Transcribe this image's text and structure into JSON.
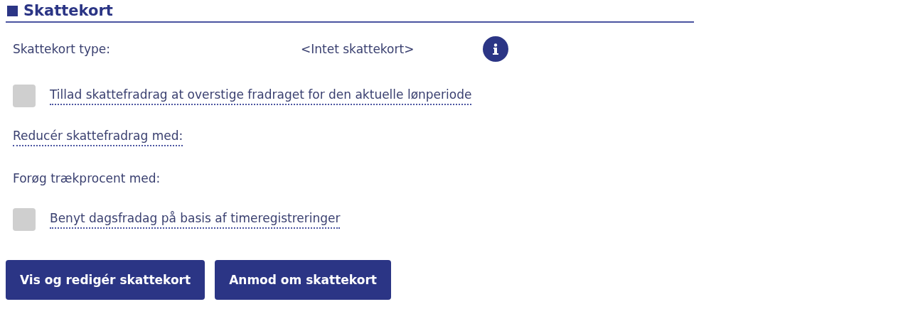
{
  "section": {
    "title": "Skattekort"
  },
  "rows": [
    {
      "kind": "value",
      "label": "Skattekort type:",
      "value": "<Intet skattekort>",
      "info": true
    },
    {
      "kind": "checkbox",
      "label": "Tillad skattefradrag at overstige fradraget for den aktuelle lønperiode",
      "checked": false
    },
    {
      "kind": "hint",
      "label": "Reducér skattefradrag med:"
    },
    {
      "kind": "plain",
      "label": "Forøg trækprocent med:"
    },
    {
      "kind": "checkbox",
      "label": "Benyt dagsfradag på basis af timeregistreringer",
      "checked": false
    }
  ],
  "buttons": [
    "Vis og redigér skattekort",
    "Anmod om skattekort"
  ]
}
